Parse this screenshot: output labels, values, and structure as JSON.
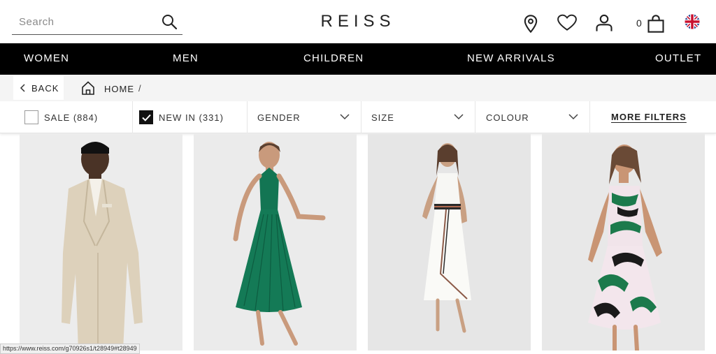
{
  "header": {
    "search_placeholder": "Search",
    "logo": "REISS",
    "bag_count": "0",
    "icons": [
      "search-icon",
      "location-pin-icon",
      "heart-icon",
      "account-icon",
      "bag-icon",
      "uk-flag-icon"
    ]
  },
  "nav": {
    "items": [
      "WOMEN",
      "MEN",
      "CHILDREN",
      "NEW ARRIVALS",
      "OUTLET"
    ]
  },
  "breadcrumb": {
    "back": "BACK",
    "home": "HOME",
    "separator": "/"
  },
  "filters": {
    "sale": {
      "label": "SALE (884)",
      "checked": false
    },
    "new_in": {
      "label": "NEW IN (331)",
      "checked": true
    },
    "gender": "GENDER",
    "size": "SIZE",
    "colour": "COLOUR",
    "more": "MORE FILTERS"
  },
  "products": [
    {
      "name": "product-tile-beige-suit"
    },
    {
      "name": "product-tile-green-halter-dress"
    },
    {
      "name": "product-tile-white-dress"
    },
    {
      "name": "product-tile-print-dress"
    }
  ],
  "status_url": "https://www.reiss.com/g70926s1/t28949#t28949",
  "colors": {
    "nav_bg": "#000000",
    "crumb_bg": "#f4f4f4",
    "tile_bg": "#e9e9e9"
  }
}
